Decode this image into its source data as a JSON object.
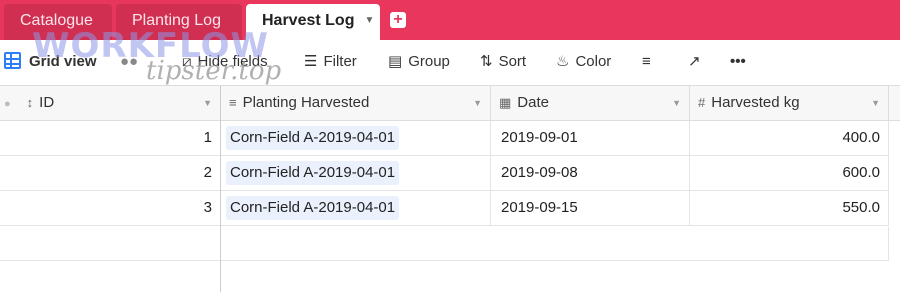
{
  "tabs": [
    {
      "label": "Catalogue"
    },
    {
      "label": "Planting Log"
    },
    {
      "label": "Harvest Log"
    }
  ],
  "add_tab_icon": "plus-square-icon",
  "toolbar": {
    "grid_view": "Grid view",
    "hide_fields": "Hide fields",
    "filter": "Filter",
    "group": "Group",
    "sort": "Sort",
    "color": "Color",
    "more": "•••"
  },
  "watermark": {
    "line1": "WORKFLOW",
    "line2": "tipster.top"
  },
  "columns": {
    "id": "ID",
    "planting": "Planting Harvested",
    "date": "Date",
    "kg": "Harvested kg"
  },
  "rows": [
    {
      "id": "1",
      "planting": "Corn-Field A-2019-04-01",
      "date": "2019-09-01",
      "kg": "400.0"
    },
    {
      "id": "2",
      "planting": "Corn-Field A-2019-04-01",
      "date": "2019-09-08",
      "kg": "600.0"
    },
    {
      "id": "3",
      "planting": "Corn-Field A-2019-04-01",
      "date": "2019-09-15",
      "kg": "550.0"
    }
  ],
  "colors": {
    "tabbar": "#e8365d",
    "accent": "#2d7ff9"
  }
}
